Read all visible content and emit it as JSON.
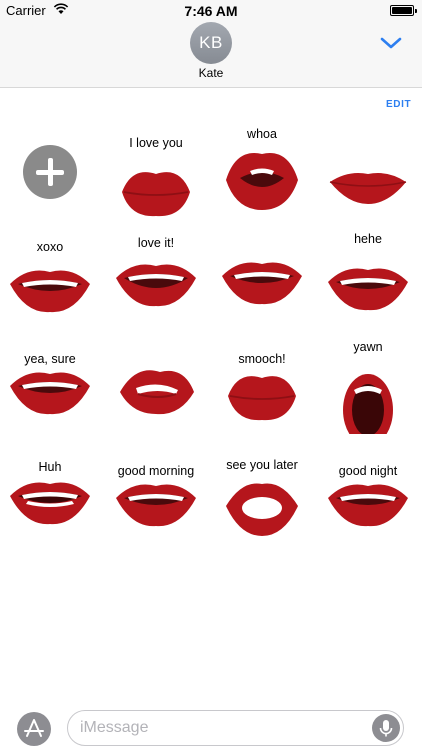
{
  "status_bar": {
    "carrier": "Carrier",
    "time": "7:46 AM",
    "wifi_icon": "wifi-icon",
    "battery_icon": "battery-icon"
  },
  "header": {
    "avatar_initials": "KB",
    "contact_name": "Kate",
    "collapse_icon": "chevron-down-icon"
  },
  "edit_label": "EDIT",
  "colors": {
    "lip_red": "#b5161c",
    "lip_dark": "#8e0f14",
    "accent_blue": "#2d7ff0",
    "gray": "#8a8a8a"
  },
  "stickers": [
    {
      "caption": "",
      "icon": "plus-icon",
      "kind": "add"
    },
    {
      "caption": "I love you",
      "icon": "lips-kiss-icon"
    },
    {
      "caption": "whoa",
      "icon": "lips-open-icon"
    },
    {
      "caption": "",
      "icon": "lips-closed-icon"
    },
    {
      "caption": "xoxo",
      "icon": "lips-smile-icon"
    },
    {
      "caption": "love it!",
      "icon": "lips-big-smile-icon"
    },
    {
      "caption": "",
      "icon": "lips-smile-icon"
    },
    {
      "caption": "hehe",
      "icon": "lips-grin-icon"
    },
    {
      "caption": "yea, sure",
      "icon": "lips-smirk-icon"
    },
    {
      "caption": "",
      "icon": "lips-bite-icon"
    },
    {
      "caption": "smooch!",
      "icon": "lips-pucker-icon"
    },
    {
      "caption": "yawn",
      "icon": "lips-yawn-icon"
    },
    {
      "caption": "Huh",
      "icon": "lips-open-teeth-icon"
    },
    {
      "caption": "good morning",
      "icon": "lips-smile-icon"
    },
    {
      "caption": "see you later",
      "icon": "lips-o-icon"
    },
    {
      "caption": "good night",
      "icon": "lips-grin-icon"
    }
  ],
  "composer": {
    "placeholder": "iMessage",
    "value": "",
    "appstore_icon": "app-store-icon",
    "mic_icon": "microphone-icon"
  }
}
